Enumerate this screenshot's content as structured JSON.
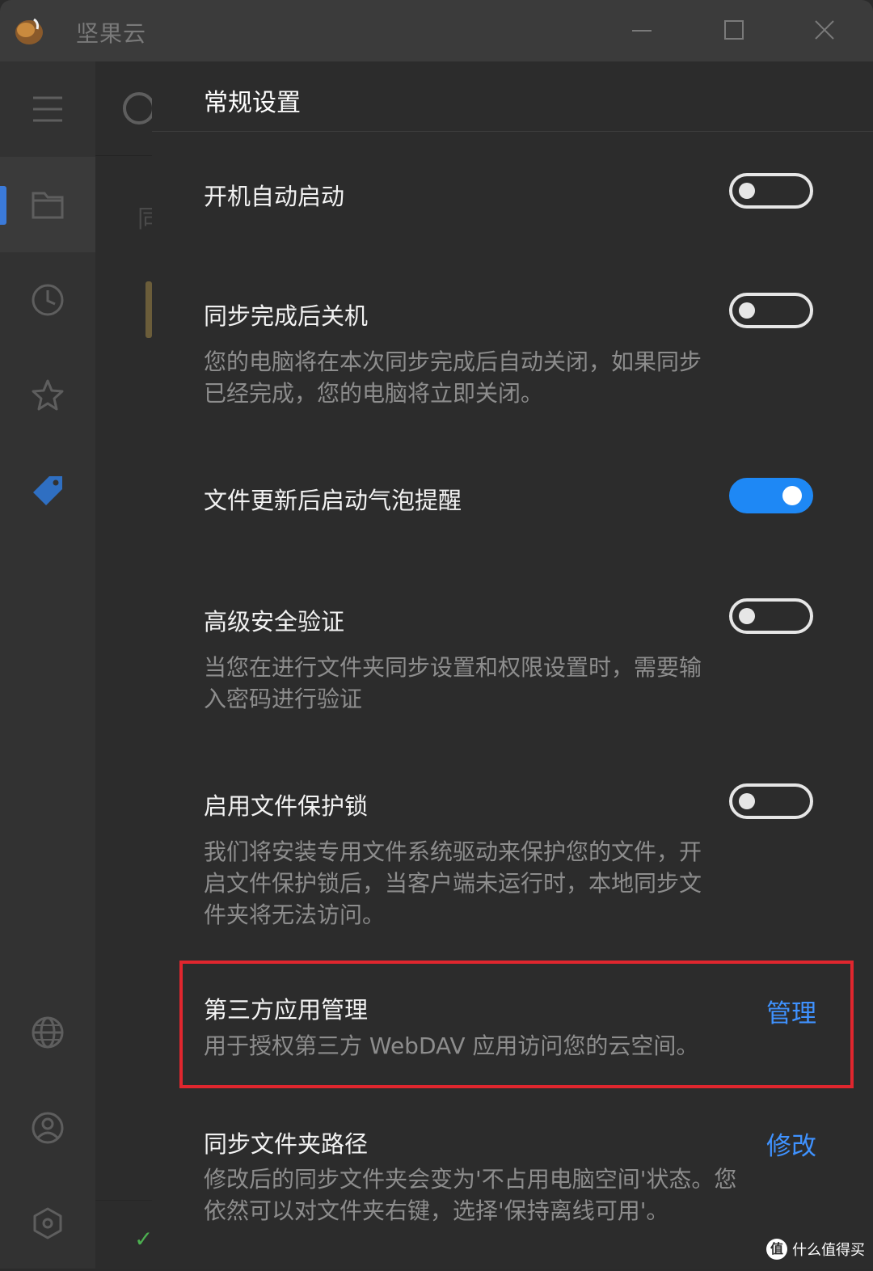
{
  "titlebar": {
    "app_title": "坚果云"
  },
  "sidebar": {
    "items": [
      {
        "icon": "menu-icon"
      },
      {
        "icon": "folder-icon",
        "active": true
      },
      {
        "icon": "clock-icon"
      },
      {
        "icon": "star-icon"
      },
      {
        "icon": "tag-icon"
      },
      {
        "icon": "globe-icon"
      },
      {
        "icon": "user-icon"
      },
      {
        "icon": "settings-hex-icon"
      }
    ]
  },
  "middle": {
    "fragment": "同"
  },
  "panel": {
    "title": "常规设置",
    "settings": [
      {
        "title": "开机自动启动",
        "enabled": false
      },
      {
        "title": "同步完成后关机",
        "desc": "您的电脑将在本次同步完成后自动关闭，如果同步已经完成，您的电脑将立即关闭。",
        "enabled": false
      },
      {
        "title": "文件更新后启动气泡提醒",
        "enabled": true
      },
      {
        "title": "高级安全验证",
        "desc": "当您在进行文件夹同步设置和权限设置时，需要输入密码进行验证",
        "enabled": false
      },
      {
        "title": "启用文件保护锁",
        "desc": "我们将安装专用文件系统驱动来保护您的文件，开启文件保护锁后，当客户端未运行时，本地同步文件夹将无法访问。",
        "enabled": false
      },
      {
        "title": "第三方应用管理",
        "desc": "用于授权第三方 WebDAV 应用访问您的云空间。",
        "action": "管理"
      },
      {
        "title": "同步文件夹路径",
        "desc": "修改后的同步文件夹会变为'不占用电脑空间'状态。您依然可以对文件夹右键，选择'保持离线可用'。",
        "action": "修改"
      }
    ]
  },
  "watermark": {
    "logo": "值",
    "text": "什么值得买"
  },
  "colors": {
    "accent": "#1e88f5",
    "link": "#3f92ff",
    "highlight": "#e0262e"
  }
}
